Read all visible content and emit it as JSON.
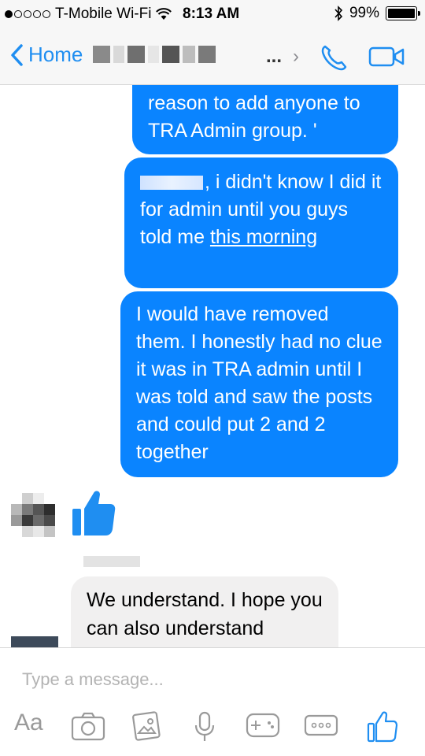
{
  "status_bar": {
    "carrier": "T-Mobile Wi-Fi",
    "time": "8:13 AM",
    "battery": "99%",
    "battery_level": 0.99
  },
  "nav": {
    "back_label": "Home",
    "ellipsis": "..."
  },
  "messages": {
    "out1": "reason to add anyone to TRA Admin group. '",
    "out2_suffix": ", i didn't know I did it for admin until you guys told me",
    "out2_link": "this morning",
    "out3": "I would have removed them. I honestly had no clue it was in TRA admin until I was told and saw the posts and could put 2 and 2 together",
    "in1": "We understand. I hope you can also understand"
  },
  "composer": {
    "placeholder": "Type a message...",
    "text_format_label": "Aa"
  },
  "colors": {
    "accent": "#1f8ef1",
    "bubble_out": "#0a84ff",
    "bubble_in": "#f1f0f0"
  },
  "icons": [
    "chevron-left-icon",
    "chevron-right-icon",
    "phone-icon",
    "video-icon",
    "thumbs-up-icon",
    "camera-icon",
    "gallery-icon",
    "microphone-icon",
    "gamepad-icon",
    "more-icon",
    "wifi-icon",
    "bluetooth-icon",
    "battery-icon"
  ]
}
